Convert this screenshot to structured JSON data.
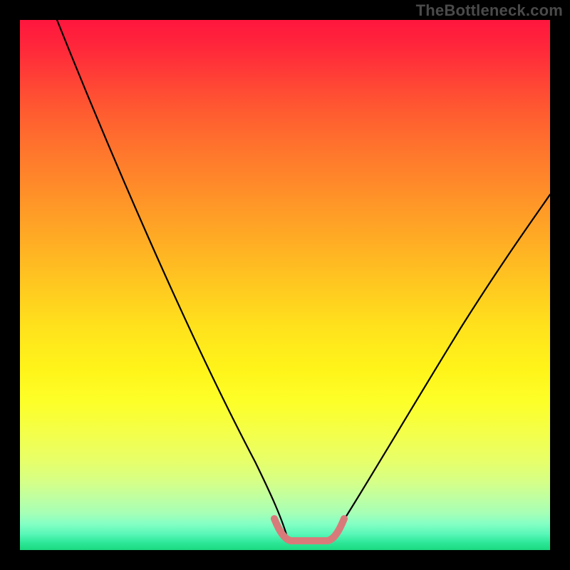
{
  "watermark": "TheBottleneck.com",
  "chart_data": {
    "type": "line",
    "title": "",
    "xlabel": "",
    "ylabel": "",
    "xlim": [
      0,
      100
    ],
    "ylim": [
      0,
      100
    ],
    "series": [
      {
        "name": "left-branch",
        "x": [
          7,
          12,
          18,
          24,
          30,
          36,
          42,
          46,
          49,
          50.5
        ],
        "y": [
          100,
          88,
          74,
          60,
          46,
          33,
          20,
          10,
          4,
          2
        ]
      },
      {
        "name": "floor",
        "x": [
          50.5,
          58.5
        ],
        "y": [
          2,
          2
        ]
      },
      {
        "name": "right-branch",
        "x": [
          58.5,
          62,
          67,
          73,
          80,
          88,
          95,
          100
        ],
        "y": [
          2,
          5,
          12,
          22,
          35,
          49,
          60,
          67
        ]
      }
    ],
    "highlight": {
      "name": "bottom-highlight",
      "color": "#d97a7a",
      "x": [
        48,
        49.5,
        50.8,
        52,
        53.2,
        54.5,
        56,
        57.5,
        59,
        60.5
      ],
      "y": [
        6,
        3.2,
        2.2,
        2,
        2,
        2,
        2,
        2.2,
        3.2,
        6
      ]
    },
    "background_gradient": {
      "top": "#ff163e",
      "mid": "#ffe21c",
      "bottom": "#1bd97f"
    }
  }
}
